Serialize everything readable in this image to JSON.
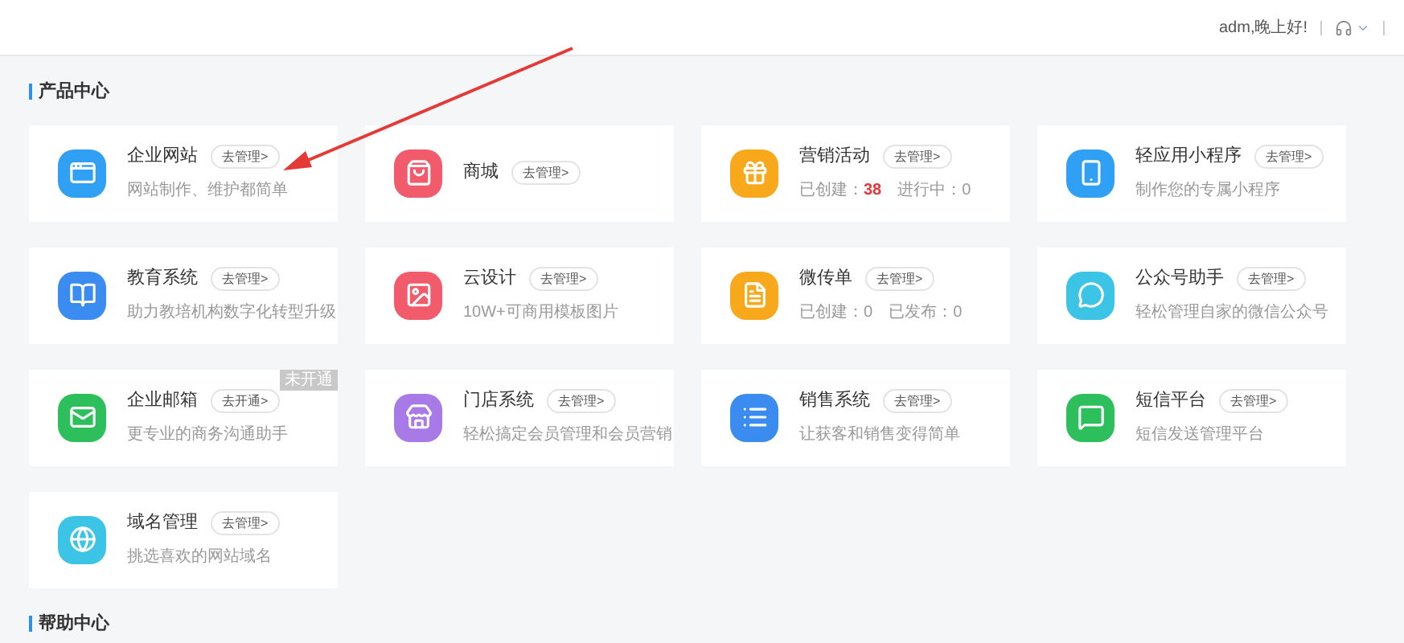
{
  "header": {
    "greeting": "adm,晚上好!"
  },
  "sections": [
    {
      "title": "产品中心",
      "items": [
        {
          "name": "企业网站",
          "action": "去管理>",
          "color": "#2fa0f4",
          "kind": "desc",
          "desc": "网站制作、维护都简单"
        },
        {
          "name": "商城",
          "action": "去管理>",
          "color": "#f15b6c",
          "kind": "plain"
        },
        {
          "name": "营销活动",
          "action": "去管理>",
          "color": "#f7a81b",
          "kind": "stats",
          "stats": [
            {
              "label": "已创建：",
              "value": "38",
              "highlight": true
            },
            {
              "label": "进行中：",
              "value": "0",
              "highlight": false
            }
          ]
        },
        {
          "name": "轻应用小程序",
          "action": "去管理>",
          "color": "#2fa0f4",
          "kind": "desc",
          "desc": "制作您的专属小程序"
        },
        {
          "name": "教育系统",
          "action": "去管理>",
          "color": "#3b8cf0",
          "kind": "desc",
          "desc": "助力教培机构数字化转型升级"
        },
        {
          "name": "云设计",
          "action": "去管理>",
          "color": "#f15b6c",
          "kind": "desc",
          "desc": "10W+可商用模板图片"
        },
        {
          "name": "微传单",
          "action": "去管理>",
          "color": "#f7a81b",
          "kind": "stats",
          "stats": [
            {
              "label": "已创建：",
              "value": "0",
              "highlight": false
            },
            {
              "label": "已发布：",
              "value": "0",
              "highlight": false
            }
          ]
        },
        {
          "name": "公众号助手",
          "action": "去管理>",
          "color": "#3cc4e6",
          "kind": "desc",
          "desc": "轻松管理自家的微信公众号"
        },
        {
          "name": "企业邮箱",
          "action": "去开通>",
          "color": "#2dbf5c",
          "kind": "desc",
          "desc": "更专业的商务沟通助手",
          "badge": "未开通"
        },
        {
          "name": "门店系统",
          "action": "去管理>",
          "color": "#a77ae8",
          "kind": "desc",
          "desc": "轻松搞定会员管理和会员营销"
        },
        {
          "name": "销售系统",
          "action": "去管理>",
          "color": "#3b8cf0",
          "kind": "desc",
          "desc": "让获客和销售变得简单"
        },
        {
          "name": "短信平台",
          "action": "去管理>",
          "color": "#2dbf5c",
          "kind": "desc",
          "desc": "短信发送管理平台"
        },
        {
          "name": "域名管理",
          "action": "去管理>",
          "color": "#3cc4e6",
          "kind": "desc",
          "desc": "挑选喜欢的网站域名"
        }
      ]
    },
    {
      "title": "帮助中心"
    }
  ]
}
